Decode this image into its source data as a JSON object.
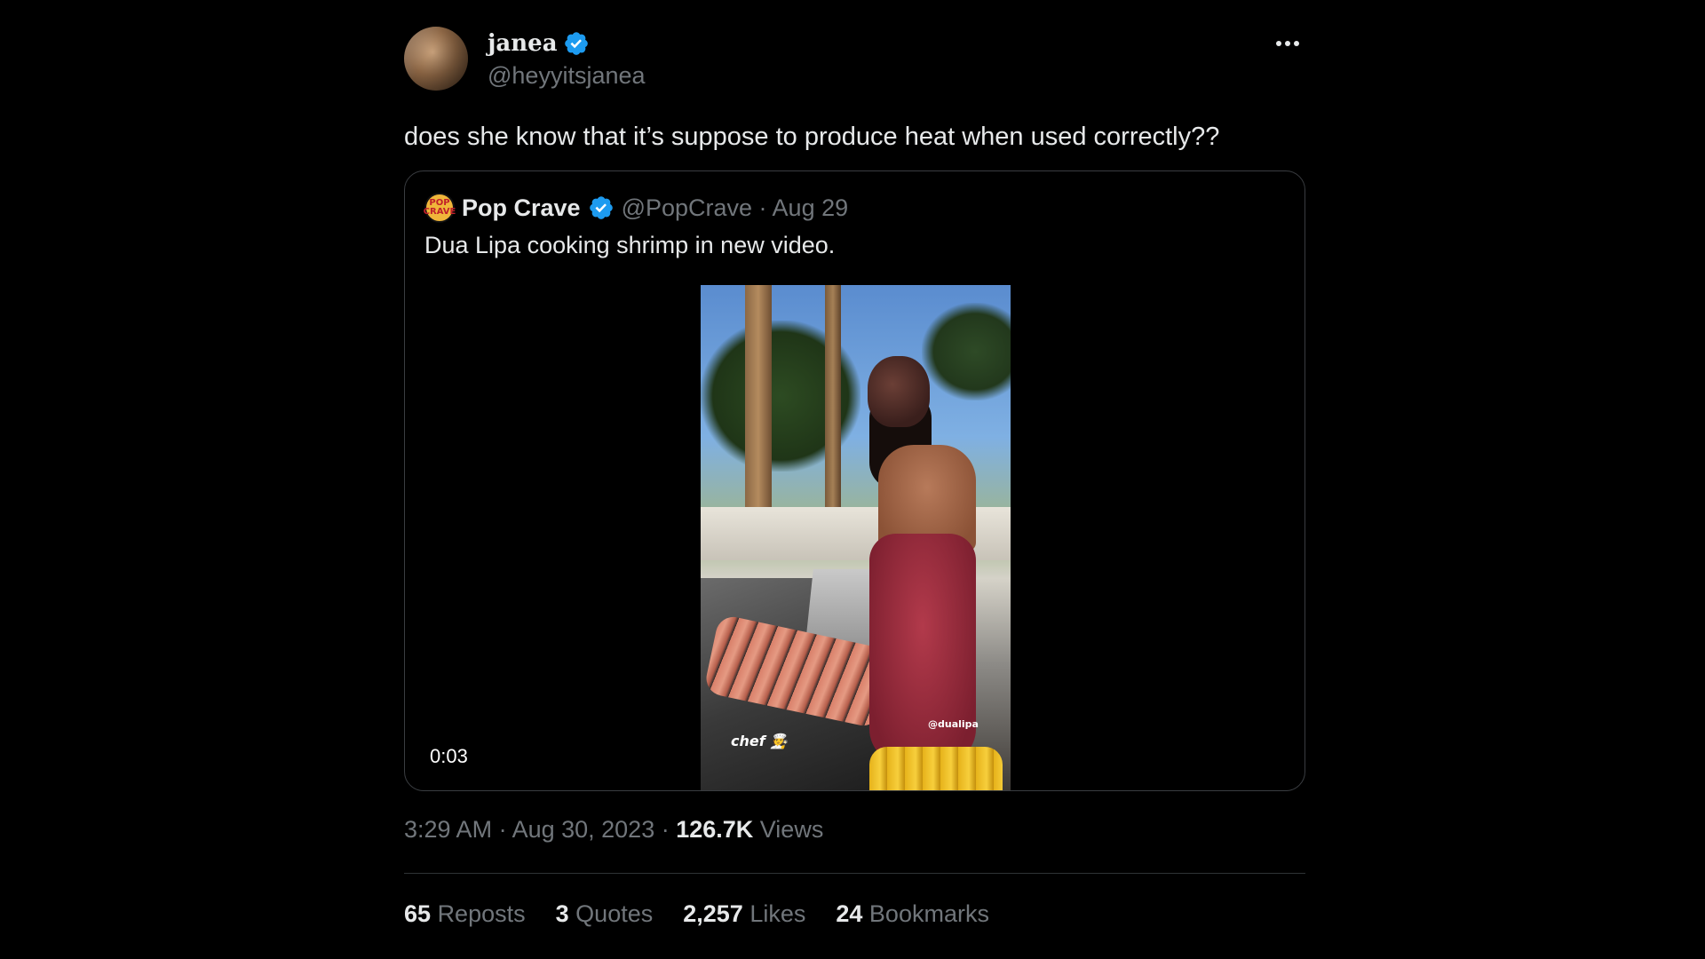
{
  "author": {
    "display_name": "janea",
    "handle": "@heyyitsjanea",
    "verified": true
  },
  "tweet_text": "does she know that it’s suppose to produce heat when used correctly??",
  "quoted": {
    "avatar_text": "POP CRAVE",
    "display_name": "Pop Crave",
    "handle_date": "@PopCrave · Aug 29",
    "text": "Dua Lipa cooking shrimp in new video.",
    "video": {
      "duration": "0:03",
      "overlay_chef": "chef 🧑‍🍳",
      "overlay_tag": "@dualipa"
    }
  },
  "meta": {
    "time_date": "3:29 AM · Aug 30, 2023 · ",
    "views_count": "126.7K",
    "views_label": " Views"
  },
  "stats": [
    {
      "num": "65",
      "label": "Reposts"
    },
    {
      "num": "3",
      "label": "Quotes"
    },
    {
      "num": "2,257",
      "label": "Likes"
    },
    {
      "num": "24",
      "label": "Bookmarks"
    }
  ],
  "colors": {
    "background": "#000000",
    "text": "#e7e9ea",
    "muted": "#71767b",
    "verified": "#1d9bf0",
    "border": "#2f3336"
  }
}
